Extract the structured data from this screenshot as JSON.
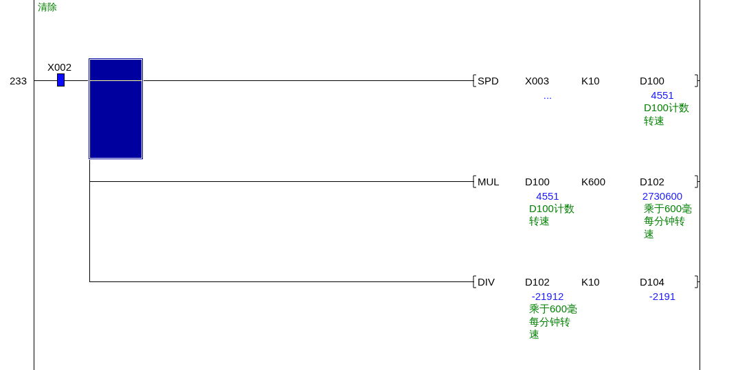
{
  "comment": "清除",
  "step": "233",
  "contact": {
    "label": "X002",
    "on": true
  },
  "instructions": [
    {
      "op": "SPD",
      "operands": [
        {
          "text": "X003",
          "value": "..."
        },
        {
          "text": "K10"
        },
        {
          "text": "D100",
          "value": "4551",
          "comment_lines": [
            "D100计数",
            "转速"
          ]
        }
      ]
    },
    {
      "op": "MUL",
      "operands": [
        {
          "text": "D100",
          "value": "4551",
          "comment_lines": [
            "D100计数",
            "转速"
          ]
        },
        {
          "text": "K600"
        },
        {
          "text": "D102",
          "value": "2730600",
          "comment_lines": [
            "乘于600毫",
            "每分钟转",
            "速"
          ]
        }
      ]
    },
    {
      "op": "DIV",
      "operands": [
        {
          "text": "D102",
          "value": "-21912",
          "comment_lines": [
            "乘于600毫",
            "每分钟转",
            "速"
          ]
        },
        {
          "text": "K10"
        },
        {
          "text": "D104",
          "value": "-2191"
        }
      ]
    }
  ]
}
